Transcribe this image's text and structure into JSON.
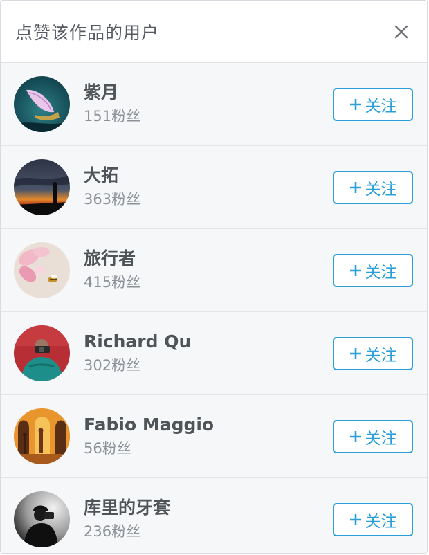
{
  "header": {
    "title": "点赞该作品的用户"
  },
  "users": [
    {
      "name": "紫月",
      "fans": "151粉丝",
      "follow_label": "关注",
      "avatar": "petal-photo"
    },
    {
      "name": "大拓",
      "fans": "363粉丝",
      "follow_label": "关注",
      "avatar": "sunset-silhouette-photo"
    },
    {
      "name": "旅行者",
      "fans": "415粉丝",
      "follow_label": "关注",
      "avatar": "flower-bee-photo"
    },
    {
      "name": "Richard Qu",
      "fans": "302粉丝",
      "follow_label": "关注",
      "avatar": "photographer-photo"
    },
    {
      "name": "Fabio Maggio",
      "fans": "56粉丝",
      "follow_label": "关注",
      "avatar": "arches-shadows-photo"
    },
    {
      "name": "库里的牙套",
      "fans": "236粉丝",
      "follow_label": "关注",
      "avatar": "bw-camera-photo"
    }
  ],
  "colors": {
    "accent": "#2a9fd8",
    "title": "#555a60",
    "name": "#4f5459",
    "muted": "#8c9197"
  },
  "icons": {
    "close": "close-icon",
    "plus": "plus-icon"
  }
}
